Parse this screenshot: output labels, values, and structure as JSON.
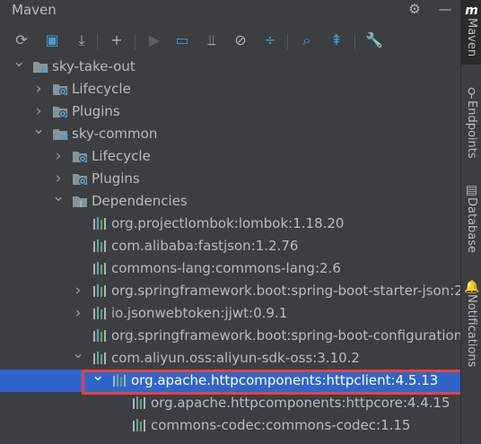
{
  "panel": {
    "title": "Maven"
  },
  "header_icons": {
    "settings": "gear-icon",
    "hide": "minimize-icon"
  },
  "toolbar": [
    {
      "name": "reload-all-button",
      "glyph": "⟳"
    },
    {
      "name": "generate-sources-button",
      "glyph": "▣"
    },
    {
      "name": "download-sources-button",
      "glyph": "⤓"
    },
    {
      "name": "add-maven-project-button",
      "glyph": "+"
    },
    {
      "name": "run-goal-button",
      "glyph": "▶"
    },
    {
      "name": "execute-goal-button",
      "glyph": "▭"
    },
    {
      "name": "toggle-offline-button",
      "glyph": "⫫"
    },
    {
      "name": "skip-tests-button",
      "glyph": "⊘"
    },
    {
      "name": "show-dependencies-button",
      "glyph": "÷"
    },
    {
      "name": "analyze-dependencies-button",
      "glyph": "⌕"
    },
    {
      "name": "collapse-all-button",
      "glyph": "⇞"
    },
    {
      "name": "maven-settings-button",
      "glyph": "🔧"
    }
  ],
  "tree": [
    {
      "label": "sky-take-out",
      "icon": "maven-module-icon",
      "expanded": true,
      "has_children": true,
      "selected": false
    },
    {
      "label": "Lifecycle",
      "icon": "folder-gear-icon",
      "expanded": false,
      "has_children": true,
      "selected": false
    },
    {
      "label": "Plugins",
      "icon": "folder-gear-icon",
      "expanded": false,
      "has_children": true,
      "selected": false
    },
    {
      "label": "sky-common",
      "icon": "maven-module-icon",
      "expanded": true,
      "has_children": true,
      "selected": false
    },
    {
      "label": "Lifecycle",
      "icon": "folder-gear-icon",
      "expanded": false,
      "has_children": true,
      "selected": false
    },
    {
      "label": "Plugins",
      "icon": "folder-gear-icon",
      "expanded": false,
      "has_children": true,
      "selected": false
    },
    {
      "label": "Dependencies",
      "icon": "folder-library-icon",
      "expanded": true,
      "has_children": true,
      "selected": false
    },
    {
      "label": "org.projectlombok:lombok:1.18.20",
      "icon": "library-icon",
      "expanded": false,
      "has_children": false,
      "selected": false
    },
    {
      "label": "com.alibaba:fastjson:1.2.76",
      "icon": "library-icon",
      "expanded": false,
      "has_children": false,
      "selected": false
    },
    {
      "label": "commons-lang:commons-lang:2.6",
      "icon": "library-icon",
      "expanded": false,
      "has_children": false,
      "selected": false
    },
    {
      "label": "org.springframework.boot:spring-boot-starter-json:2",
      "icon": "library-icon",
      "expanded": false,
      "has_children": true,
      "selected": false
    },
    {
      "label": "io.jsonwebtoken:jjwt:0.9.1",
      "icon": "library-icon",
      "expanded": false,
      "has_children": true,
      "selected": false
    },
    {
      "label": "org.springframework.boot:spring-boot-configuration",
      "icon": "library-icon",
      "expanded": false,
      "has_children": false,
      "selected": false
    },
    {
      "label": "com.aliyun.oss:aliyun-sdk-oss:3.10.2",
      "icon": "library-icon",
      "expanded": true,
      "has_children": true,
      "selected": false
    },
    {
      "label": "org.apache.httpcomponents:httpclient:4.5.13",
      "icon": "library-icon",
      "expanded": true,
      "has_children": true,
      "selected": true
    },
    {
      "label": "org.apache.httpcomponents:httpcore:4.4.15",
      "icon": "library-icon",
      "expanded": false,
      "has_children": false,
      "selected": false
    },
    {
      "label": "commons-codec:commons-codec:1.15",
      "icon": "library-icon",
      "expanded": false,
      "has_children": false,
      "selected": false
    }
  ],
  "sidebar": [
    {
      "label": "Maven",
      "icon": "maven-icon",
      "active": true
    },
    {
      "label": "Endpoints",
      "icon": "endpoints-icon",
      "active": false
    },
    {
      "label": "Database",
      "icon": "database-icon",
      "active": false
    },
    {
      "label": "Notifications",
      "icon": "bell-icon",
      "active": false
    }
  ],
  "colors": {
    "background": "#3c3f41",
    "selection": "#2f65ca",
    "highlight_border": "#e8423f",
    "library_icon": "#6a9fb5"
  }
}
